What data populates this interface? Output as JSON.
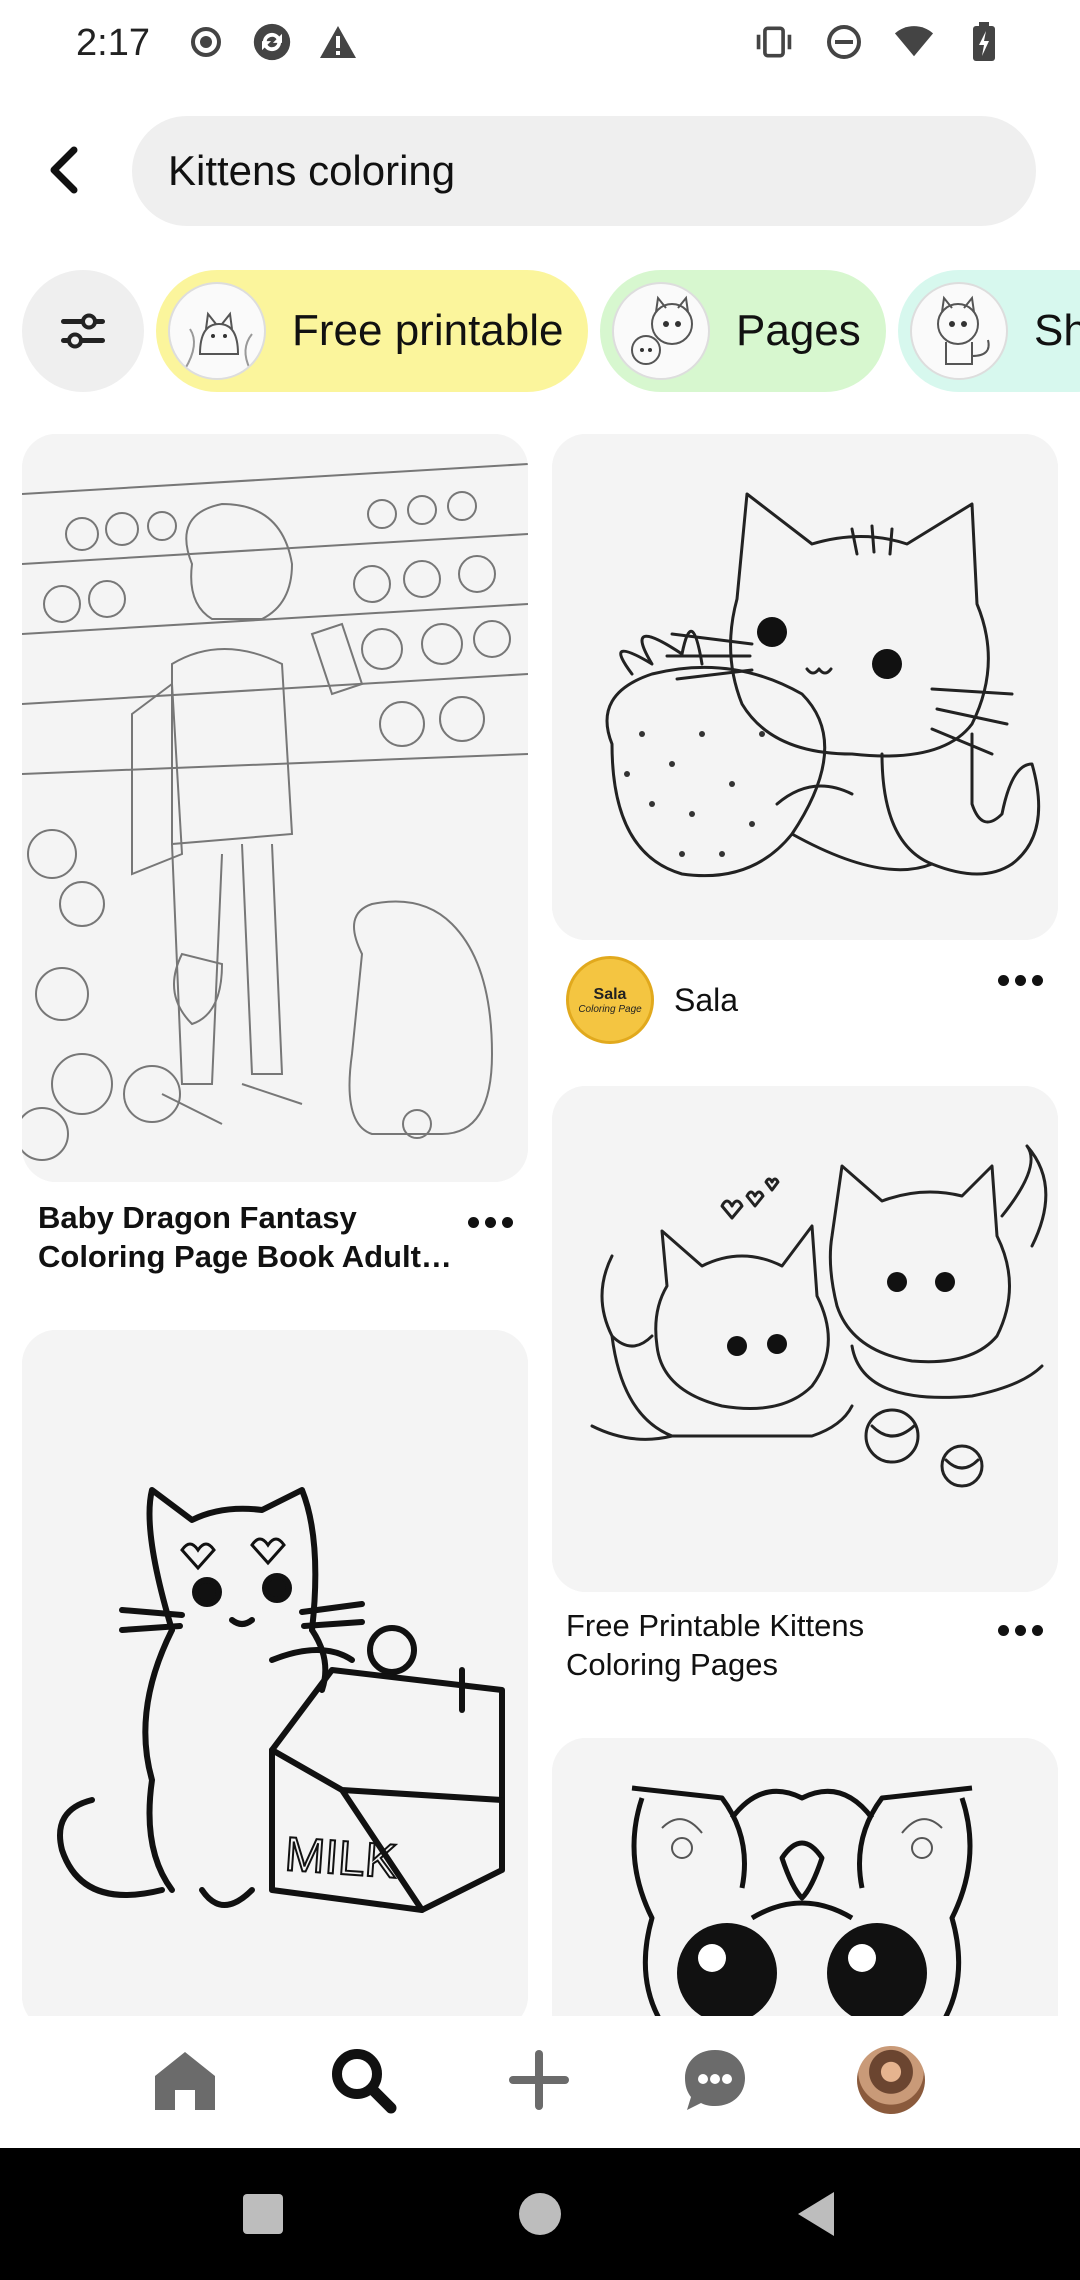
{
  "status_bar": {
    "time": "2:17",
    "left_icons": [
      "record-icon",
      "sync-icon",
      "warning-icon"
    ],
    "right_icons": [
      "vibrate-icon",
      "do-not-disturb-icon",
      "wifi-icon",
      "battery-charging-icon"
    ]
  },
  "search": {
    "value": "Kittens coloring",
    "back_icon": "chevron-left-icon"
  },
  "filters": {
    "filter_icon": "sliders-icon",
    "chips": [
      {
        "label": "Free printable",
        "color": "#fbf59c"
      },
      {
        "label": "Pages",
        "color": "#d7f7cf"
      },
      {
        "label": "Sh",
        "color": "#d7f8ee"
      }
    ]
  },
  "pins": {
    "pin1": {
      "title_line1": "Baby Dragon Fantasy",
      "title_line2": "Coloring Page Book Adult…"
    },
    "pin2": {
      "creator_name": "Sala",
      "avatar_text1": "Sala",
      "avatar_text2": "Coloring Page"
    },
    "pin3": {
      "title_line1": "Free Printable Kittens",
      "title_line2": "Coloring Pages"
    },
    "pin4": {
      "milk_text": "MILK"
    }
  },
  "bottom_nav": {
    "items": [
      "home-icon",
      "search-icon",
      "plus-icon",
      "messages-icon",
      "profile-avatar"
    ],
    "active": "search-icon"
  },
  "system_nav": [
    "recents-icon",
    "home-circle-icon",
    "back-triangle-icon"
  ]
}
